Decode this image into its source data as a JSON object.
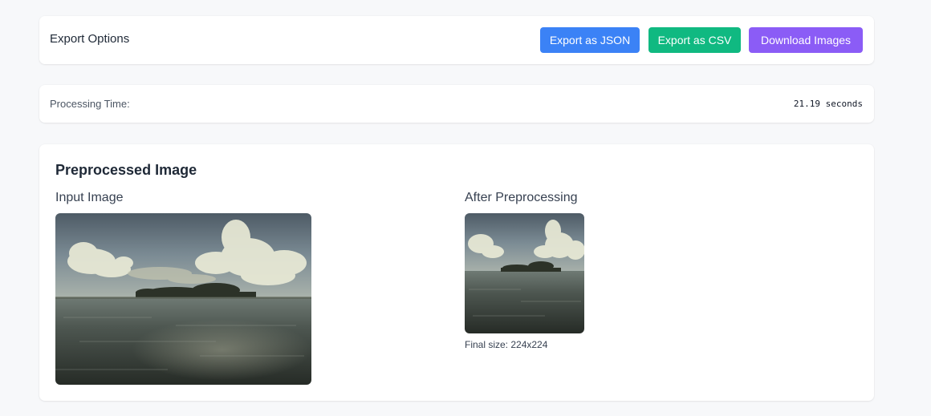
{
  "export": {
    "title": "Export Options",
    "buttons": {
      "json": "Export as JSON",
      "csv": "Export as CSV",
      "images": "Download Images"
    }
  },
  "processing": {
    "label": "Processing Time:",
    "value": "21.19 seconds"
  },
  "preprocessed": {
    "title": "Preprocessed Image",
    "input_label": "Input Image",
    "after_label": "After Preprocessing",
    "final_size": "Final size: 224x224"
  },
  "colors": {
    "json_button": "#3b82f6",
    "csv_button": "#10b981",
    "images_button": "#8b5cf6"
  },
  "images": {
    "input": "tropical-island-seascape-photo",
    "after": "tropical-island-seascape-photo-square"
  }
}
